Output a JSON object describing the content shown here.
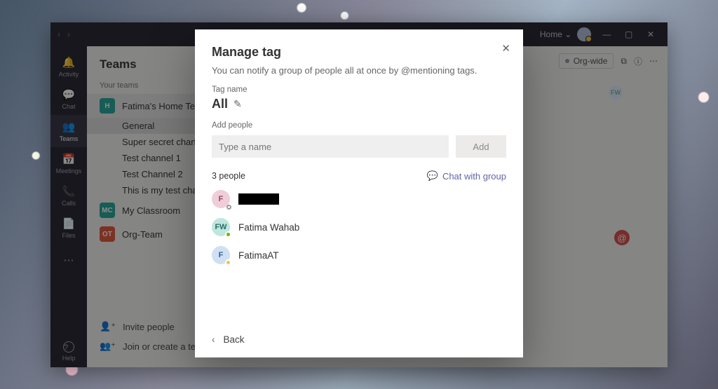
{
  "titlebar": {
    "home_label": "Home"
  },
  "rail": {
    "items": [
      {
        "icon": "🔔",
        "label": "Activity"
      },
      {
        "icon": "💬",
        "label": "Chat"
      },
      {
        "icon": "👥",
        "label": "Teams"
      },
      {
        "icon": "📅",
        "label": "Meetings"
      },
      {
        "icon": "📞",
        "label": "Calls"
      },
      {
        "icon": "📄",
        "label": "Files"
      },
      {
        "icon": "⋯",
        "label": ""
      }
    ],
    "help": {
      "icon": "?",
      "label": "Help"
    }
  },
  "teams": {
    "header": "Teams",
    "section": "Your teams",
    "list": [
      {
        "badge": "H",
        "name": "Fatima's Home Team",
        "channels": [
          "General",
          "Super secret channel",
          "Test channel 1",
          "Test Channel 2",
          "This is my test channel"
        ]
      },
      {
        "badge": "MC",
        "name": "My Classroom",
        "channels": []
      },
      {
        "badge": "OT",
        "name": "Org-Team",
        "channels": []
      }
    ],
    "footer": {
      "invite": "Invite people",
      "join": "Join or create a team"
    }
  },
  "content": {
    "orgwide": "Org-wide",
    "fw_chip": "FW",
    "at": "@"
  },
  "modal": {
    "title": "Manage tag",
    "subtitle": "You can notify a group of people all at once by @mentioning tags.",
    "tagname_label": "Tag name",
    "tagname_value": "All",
    "addpeople_label": "Add people",
    "add_placeholder": "Type a name",
    "add_button": "Add",
    "count_label": "3 people",
    "chat_link": "Chat with group",
    "people": [
      {
        "initials": "F",
        "name_redacted": true,
        "name": "",
        "presence": "offline",
        "cls": "f1"
      },
      {
        "initials": "FW",
        "name_redacted": false,
        "name": "Fatima Wahab",
        "presence": "avail",
        "cls": "f2"
      },
      {
        "initials": "F",
        "name_redacted": false,
        "name": "FatimaAT",
        "presence": "away",
        "cls": "f3"
      }
    ],
    "back": "Back"
  }
}
